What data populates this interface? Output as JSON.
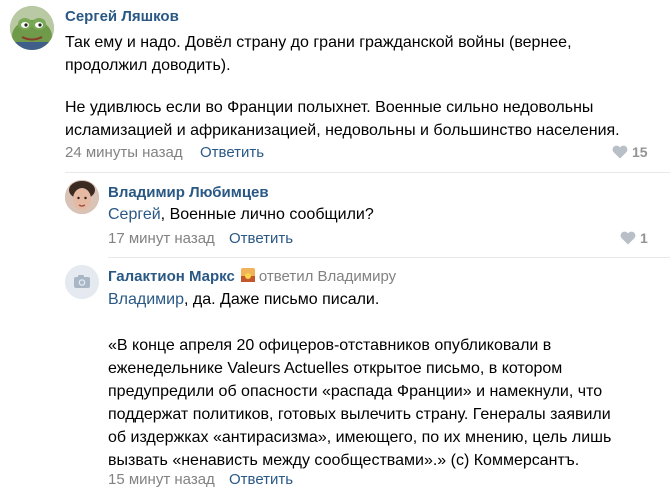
{
  "comments": [
    {
      "author": "Сергей Ляшков",
      "text_lines": [
        "Так ему и надо. Довёл страну до грани гражданской войны (вернее,",
        "продолжил доводить).",
        "",
        "Не удивлюсь если во Франции полыхнет. Военные сильно недовольны",
        "исламизацией и африканизацией, недовольны и большинство населения."
      ],
      "time": "24 минуты назад",
      "reply_label": "Ответить",
      "likes": "15"
    },
    {
      "author": "Владимир Любимцев",
      "mention": "Сергей",
      "text_rest": ", Военные лично сообщили?",
      "time": "17 минут назад",
      "reply_label": "Ответить",
      "likes": "1"
    },
    {
      "author": "Галактион Маркс",
      "replied_to": "ответил Владимиру",
      "mention": "Владимир",
      "text_rest": ", да. Даже письмо писали.",
      "quote_lines": [
        "«В конце апреля 20 офицеров-отставников опубликовали в",
        "еженедельнике Valeurs Actuelles открытое письмо, в котором",
        "предупредили об опасности «распада Франции» и намекнули, что",
        "поддержат политиков, готовых вылечить страну. Генералы заявили",
        "об издержках «антирасизма», имеющего, по их мнению, цель лишь",
        "вызвать «ненависть между сообществами».» (с) Коммерсантъ."
      ],
      "time": "15 минут назад",
      "reply_label": "Ответить"
    }
  ],
  "icons": {
    "like": "heart-icon",
    "camera": "camera-icon",
    "fire": "sunset-emoji-icon"
  },
  "colors": {
    "link": "#2a5885",
    "meta": "#828282",
    "divider": "#e7e8ec"
  }
}
